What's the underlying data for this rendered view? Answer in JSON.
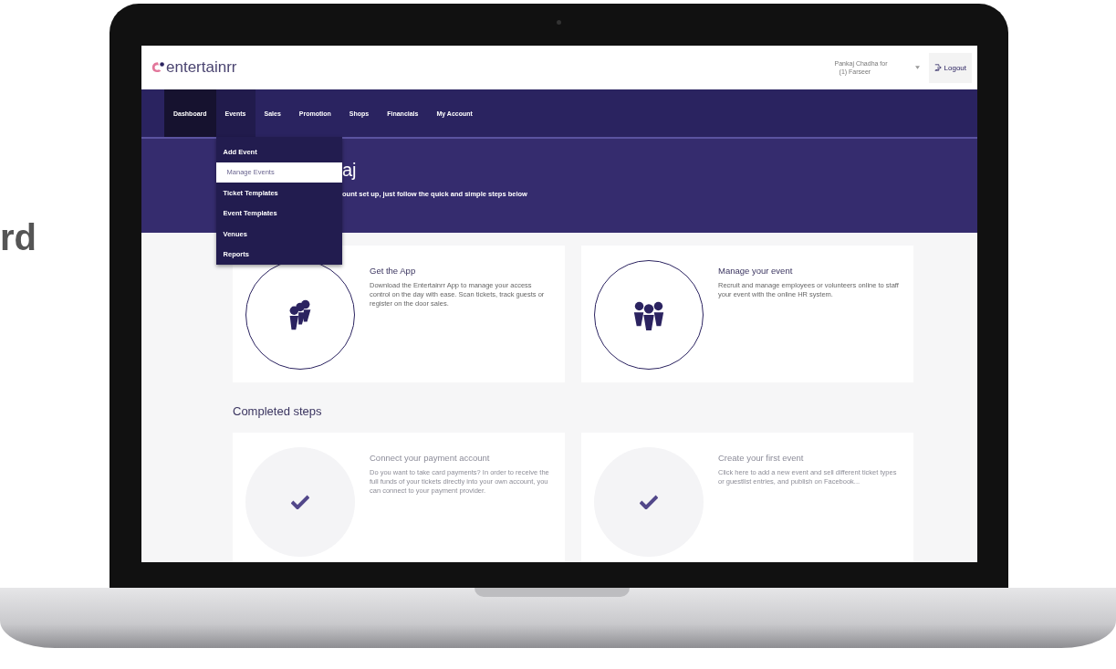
{
  "backdrop_text": "rd",
  "header": {
    "logo": "entertainrr",
    "account": {
      "name": "Pankaj Chadha for",
      "org": "(1) Farseer"
    },
    "logout": "Logout"
  },
  "nav": [
    {
      "label": "Dashboard",
      "selected": true,
      "expanded": false
    },
    {
      "label": "Events",
      "selected": false,
      "expanded": true
    },
    {
      "label": "Sales",
      "selected": false,
      "expanded": false
    },
    {
      "label": "Promotion",
      "selected": false,
      "expanded": false
    },
    {
      "label": "Shops",
      "selected": false,
      "expanded": false
    },
    {
      "label": "Financials",
      "selected": false,
      "expanded": false
    },
    {
      "label": "My Account",
      "selected": false,
      "expanded": false
    }
  ],
  "menu": [
    {
      "label": "Add Event",
      "selected": false
    },
    {
      "label": "Manage Events",
      "selected": true
    },
    {
      "label": "Ticket Templates",
      "selected": false
    },
    {
      "label": "Event Templates",
      "selected": false
    },
    {
      "label": "Venues",
      "selected": false
    },
    {
      "label": "Reports",
      "selected": false
    }
  ],
  "hero": {
    "title": "aj",
    "subtitle": "ount set up, just follow the quick and simple steps below"
  },
  "steps": [
    {
      "kind": "app",
      "completed": false,
      "title": "Get the App",
      "text": "Download the Entertainrr App to manage your access control on the day with ease. Scan tickets, track guests or register on the door sales."
    },
    {
      "kind": "team",
      "completed": false,
      "title": "Manage your event",
      "text": "Recruit and manage employees or volunteers online to staff your event with the online HR system."
    }
  ],
  "completed_section": {
    "title": "Completed steps",
    "steps": [
      {
        "kind": "check",
        "completed": true,
        "title": "Connect your payment account",
        "text": "Do you want to take card payments? In order to receive the full funds of your tickets directly into your own account, you can connect to your payment provider."
      },
      {
        "kind": "check",
        "completed": true,
        "title": "Create your first event",
        "text": "Click here to add a new event and sell different ticket types or guestlist entries, and publish on Facebook..."
      }
    ]
  }
}
